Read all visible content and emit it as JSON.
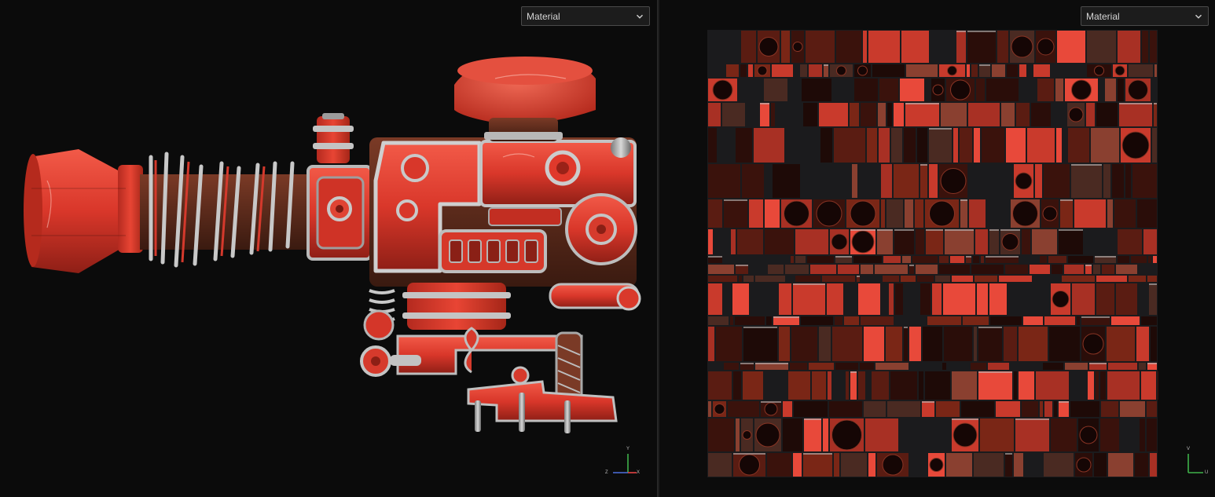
{
  "viewport_3d": {
    "material_dropdown": {
      "selected": "Material"
    },
    "axis_gizmo": {
      "y": "Y",
      "z": "Z",
      "x": "X"
    }
  },
  "viewport_2d": {
    "material_dropdown": {
      "selected": "Material"
    },
    "axis_gizmo": {
      "v": "V",
      "u": "U"
    }
  },
  "colors": {
    "background": "#0b0b0b",
    "paint_red": "#e0392b",
    "worn_metal": "#a9a9a9",
    "uv_gap": "#1b1b1d",
    "dropdown_bg": "#1c1c1c",
    "dropdown_text": "#d6d6d6",
    "axis_green": "#3fb14a",
    "axis_blue": "#4d6fe0",
    "axis_red": "#e34444"
  },
  "icons": {
    "dropdown": "chevron-down-icon",
    "gizmo_3d": "axis-gizmo-3d-icon",
    "gizmo_uv": "axis-gizmo-uv-icon"
  }
}
